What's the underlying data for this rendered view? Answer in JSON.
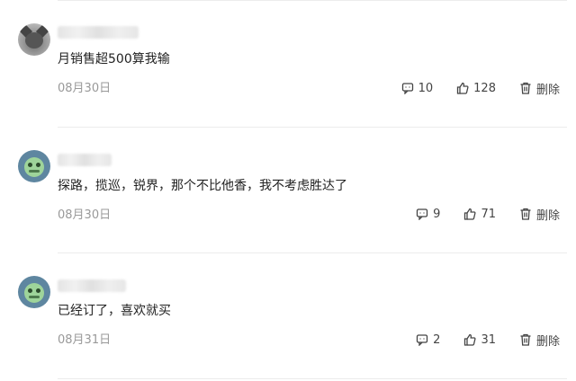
{
  "comments": [
    {
      "avatar": "cat-avatar",
      "text": "月销售超500算我输",
      "date": "08月30日",
      "reply_count": "10",
      "like_count": "128",
      "delete_label": "删除"
    },
    {
      "avatar": "frog-avatar",
      "text": "探路，揽巡，锐界，那个不比他香，我不考虑胜达了",
      "date": "08月30日",
      "reply_count": "9",
      "like_count": "71",
      "delete_label": "删除"
    },
    {
      "avatar": "frog-avatar",
      "text": "已经订了，喜欢就买",
      "date": "08月31日",
      "reply_count": "2",
      "like_count": "31",
      "delete_label": "删除"
    }
  ]
}
